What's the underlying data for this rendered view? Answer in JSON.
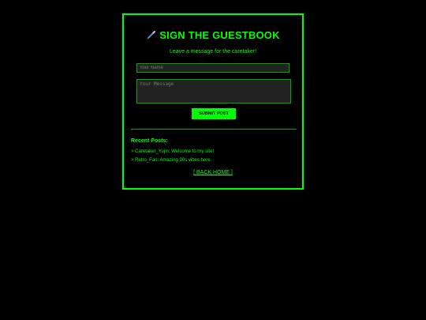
{
  "guestbook": {
    "title": "SIGN THE GUESTBOOK",
    "title_icon": "pen-icon",
    "subtitle": "Leave a message for the caretaker!",
    "name_placeholder": "Your Name",
    "name_value": "",
    "message_placeholder": "Your Message",
    "message_value": "",
    "submit_label": "SUBMIT POST"
  },
  "recent": {
    "heading": "Recent Posts:",
    "posts": [
      {
        "text": "> Caretaker_Yujin: Welcome to my site!"
      },
      {
        "text": "> Retro_Fan: Amazing 90s vibes here."
      }
    ]
  },
  "back_link": "[ BACK HOME ]",
  "colors": {
    "background": "#000000",
    "accent": "#00ff00",
    "border": "#00ff00",
    "input_background": "#222222"
  }
}
